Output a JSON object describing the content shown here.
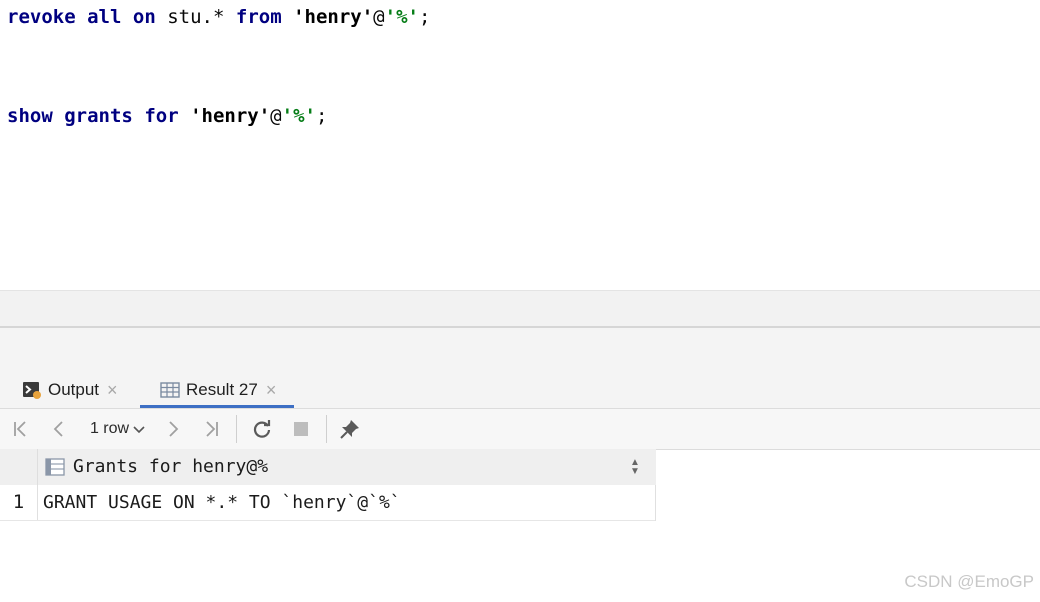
{
  "editor": {
    "line1": {
      "kw1": "revoke",
      "kw2": "all",
      "kw3": "on",
      "obj": "stu.*",
      "kw4": "from",
      "user": "'henry'",
      "at": "@",
      "host": "'%'",
      "end": ";"
    },
    "line2": {
      "kw1": "show",
      "kw2": "grants",
      "kw3": "for",
      "user": "'henry'",
      "at": "@",
      "host": "'%'",
      "end": ";"
    }
  },
  "tabs": [
    {
      "label": "Output",
      "icon": "console-output-icon",
      "close": "×"
    },
    {
      "label": "Result 27",
      "icon": "table-grid-icon",
      "close": "×",
      "active": true
    }
  ],
  "toolbar": {
    "rows_label": "1 row",
    "buttons": [
      "first-page-icon",
      "prev-page-icon",
      "next-page-icon",
      "last-page-icon",
      "refresh-icon",
      "stop-icon",
      "pin-icon"
    ]
  },
  "result": {
    "column": "Grants for henry@%",
    "rows": [
      {
        "num": "1",
        "value": "GRANT USAGE ON *.* TO `henry`@`%`"
      }
    ]
  },
  "watermark": "CSDN @EmoGP",
  "colors": {
    "keyword": "#000080",
    "string_green": "#067d17",
    "active_tab": "#3d6fc4"
  }
}
